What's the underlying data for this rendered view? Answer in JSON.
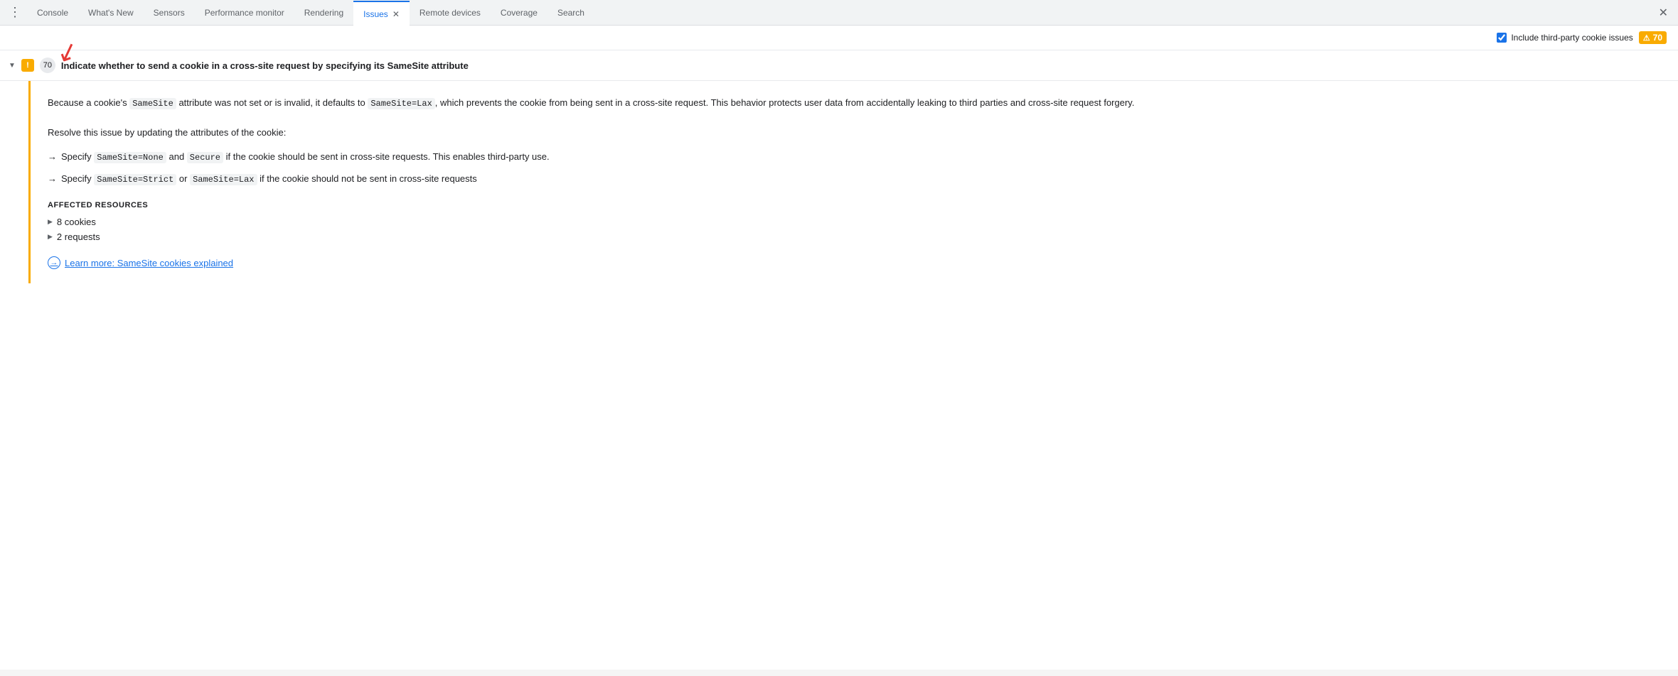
{
  "tabs": [
    {
      "id": "dots",
      "label": "⋮",
      "active": false,
      "closable": false
    },
    {
      "id": "console",
      "label": "Console",
      "active": false,
      "closable": false
    },
    {
      "id": "whats-new",
      "label": "What's New",
      "active": false,
      "closable": false
    },
    {
      "id": "sensors",
      "label": "Sensors",
      "active": false,
      "closable": false
    },
    {
      "id": "performance-monitor",
      "label": "Performance monitor",
      "active": false,
      "closable": false
    },
    {
      "id": "rendering",
      "label": "Rendering",
      "active": false,
      "closable": false
    },
    {
      "id": "issues",
      "label": "Issues",
      "active": true,
      "closable": true
    },
    {
      "id": "remote-devices",
      "label": "Remote devices",
      "active": false,
      "closable": false
    },
    {
      "id": "coverage",
      "label": "Coverage",
      "active": false,
      "closable": false
    },
    {
      "id": "search",
      "label": "Search",
      "active": false,
      "closable": false
    }
  ],
  "close_label": "✕",
  "header": {
    "checkbox_label": "Include third-party cookie issues",
    "badge_count": "70"
  },
  "issue": {
    "chevron": "▼",
    "icon_symbol": "!",
    "count": "70",
    "title": "Indicate whether to send a cookie in a cross-site request by specifying its SameSite attribute",
    "detail": {
      "paragraph1_parts": [
        {
          "type": "text",
          "value": "Because a cookie's "
        },
        {
          "type": "code",
          "value": "SameSite"
        },
        {
          "type": "text",
          "value": " attribute was not set or is invalid, it defaults to "
        },
        {
          "type": "code",
          "value": "SameSite=Lax"
        },
        {
          "type": "text",
          "value": ", which prevents the cookie from being sent in a cross-site request. This behavior protects user data from accidentally leaking to third parties and cross-site request forgery."
        }
      ],
      "paragraph2": "Resolve this issue by updating the attributes of the cookie:",
      "bullets": [
        {
          "text_parts": [
            {
              "type": "text",
              "value": "Specify "
            },
            {
              "type": "code",
              "value": "SameSite=None"
            },
            {
              "type": "text",
              "value": " and "
            },
            {
              "type": "code",
              "value": "Secure"
            },
            {
              "type": "text",
              "value": " if the cookie should be sent in cross-site requests. This enables third-party use."
            }
          ]
        },
        {
          "text_parts": [
            {
              "type": "text",
              "value": "Specify "
            },
            {
              "type": "code",
              "value": "SameSite=Strict"
            },
            {
              "type": "text",
              "value": " or "
            },
            {
              "type": "code",
              "value": "SameSite=Lax"
            },
            {
              "type": "text",
              "value": " if the cookie should not be sent in cross-site requests"
            }
          ]
        }
      ],
      "affected_resources_title": "AFFECTED RESOURCES",
      "resources": [
        {
          "label": "8 cookies"
        },
        {
          "label": "2 requests"
        }
      ],
      "learn_more_text": "Learn more: SameSite cookies explained"
    }
  }
}
